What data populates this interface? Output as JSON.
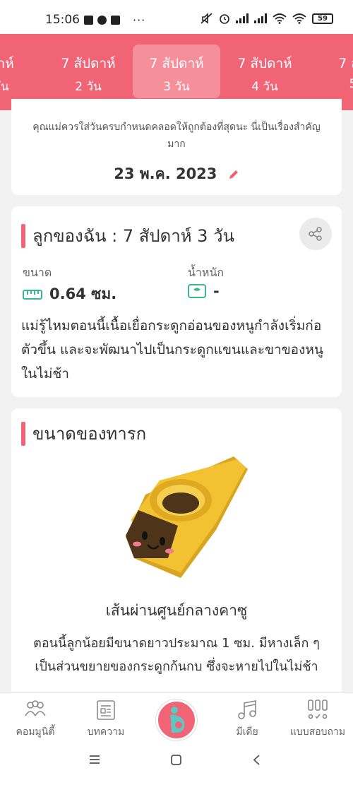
{
  "status_bar": {
    "time": "15:06",
    "dots": "···",
    "battery": "59"
  },
  "weeks": [
    {
      "week": "ดาห์",
      "day": "วัน"
    },
    {
      "week": "7 สัปดาห์",
      "day": "2 วัน"
    },
    {
      "week": "7 สัปดาห์",
      "day": "3 วัน"
    },
    {
      "week": "7 สัปดาห์",
      "day": "4 วัน"
    },
    {
      "week": "7 สับ",
      "day": "5"
    }
  ],
  "due_card": {
    "notice": "คุณแม่ควรใส่วันครบกำหนดคลอดให้ถูกต้องที่สุดนะ นี่เป็นเรื่องสำคัญมาก",
    "date": "23 พ.ค. 2023"
  },
  "baby_card": {
    "title": "ลูกของฉัน : 7 สัปดาห์ 3  วัน",
    "size_label": "ขนาด",
    "size_value": "0.64 ซม.",
    "weight_label": "น้ำหนัก",
    "weight_value": "-",
    "description": "แม่รู้ไหมตอนนี้เนื้อเยื่อกระดูกอ่อนของหนูกำลังเริ่มก่อตัวขึ้น และจะพัฒนาไปเป็นกระดูกแขนและขาของหนูในไม่ช้า"
  },
  "size_card": {
    "title": "ขนาดของทารก",
    "object_name": "เส้นผ่านศูนย์กลางคาซู",
    "description": "ตอนนี้ลูกน้อยมีขนาดยาวประมาณ 1 ซม. มีหางเล็ก ๆ เป็นส่วนขยายของกระดูกก้นกบ ซึ่งจะหายไปในไม่ช้า"
  },
  "bottom_nav": {
    "community": "คอมมูนิตี้",
    "articles": "บทความ",
    "media": "มีเดีย",
    "quiz": "แบบสอบถาม"
  },
  "colors": {
    "accent": "#f06475",
    "measure_green": "#3bb78f",
    "kazoo_gold": "#f0c030"
  },
  "icons": [
    "ruler-icon",
    "scale-icon",
    "pencil-icon",
    "share-icon",
    "community-icon",
    "article-icon",
    "music-icon",
    "quiz-icon",
    "pregnancy-icon"
  ]
}
